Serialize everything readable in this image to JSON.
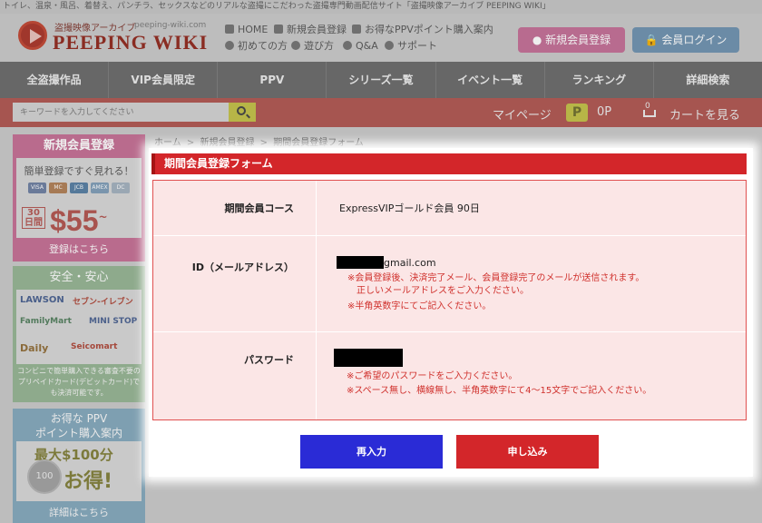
{
  "topbar": {
    "text": "トイレ、温泉・風呂、着替え、パンチラ、セックスなどのリアルな盗撮にこだわった盗撮専門動画配信サイト「盗撮映像アーカイブ PEEPING WIKI」"
  },
  "logo": {
    "subtitle": "盗撮映像アーカイブ",
    "url": "peeping-wiki.com",
    "name": "PEEPING WIKI"
  },
  "header_nav": {
    "home": "HOME",
    "new_registration": "新規会員登録",
    "ppv_points": "お得なPPVポイント購入案内",
    "first_time": "初めての方",
    "how_to": "遊び方",
    "qa": "Q&A",
    "support": "サポート"
  },
  "buttons": {
    "register": "新規会員登録",
    "login": "会員ログイン"
  },
  "main_nav": [
    "全盗撮作品",
    "VIP会員限定",
    "PPV",
    "シリーズ一覧",
    "イベント一覧",
    "ランキング",
    "詳細検索"
  ],
  "search": {
    "placeholder": "キーワードを入力してください",
    "mypage": "マイページ",
    "points_icon": "P",
    "points": "0P",
    "cart_count": "0",
    "cart_label": "カートを見る"
  },
  "sidebar": {
    "registration": {
      "title": "新規会員登録",
      "subtitle": "簡単登録ですぐ見れる！",
      "cards": [
        "VISA",
        "MC",
        "JCB",
        "AMEX",
        "DC"
      ],
      "days_top": "30",
      "days_bottom": "日間",
      "price": "$55",
      "price_suffix": "~",
      "footer": "登録はこちら"
    },
    "safety": {
      "title": "安全・安心",
      "stores": [
        "LAWSON",
        "セブン-イレブン",
        "FamilyMart",
        "MINI STOP",
        "Daily",
        "Seicomart"
      ],
      "footer": "コンビニで簡単購入できる審査不要のプリペイドカード(デビットカード)でも決済可能です。"
    },
    "ppv": {
      "title_line1": "お得な PPV",
      "title_line2": "ポイント購入案内",
      "coin_label": "100",
      "max_label": "最大$100分",
      "deal_label": "お得!",
      "footer": "詳細はこちら"
    }
  },
  "breadcrumb": {
    "home": "ホーム",
    "new_registration": "新規会員登録",
    "current": "期間会員登録フォーム",
    "separator": ">"
  },
  "form": {
    "title": "期間会員登録フォーム",
    "course_label": "期間会員コース",
    "course_value": "ExpressVIPゴールド会員 90日",
    "id_label": "ID（メールアドレス）",
    "id_value_suffix": "gmail.com",
    "id_note1": "※会員登録後、決済完了メール、会員登録完了のメールが送信されます。",
    "id_note2": "正しいメールアドレスをご入力ください。",
    "id_note3": "※半角英数字にてご記入ください。",
    "password_label": "パスワード",
    "password_note1": "※ご希望のパスワードをご入力ください。",
    "password_note2": "※スペース無し、横線無し、半角英数字にて4～15文字でご記入ください。",
    "reset_button": "再入力",
    "submit_button": "申し込み"
  },
  "colors": {
    "accent_red": "#d3262a",
    "reset_blue": "#2a2bd6",
    "form_bg": "#fbe6e6"
  }
}
